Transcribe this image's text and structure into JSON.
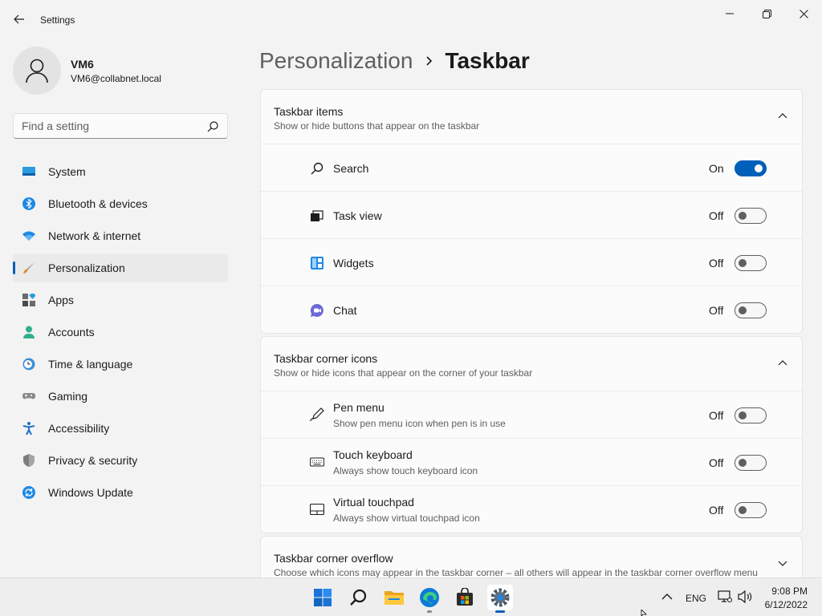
{
  "window": {
    "title": "Settings",
    "back_icon": "back-arrow-icon",
    "controls": [
      "minimize-icon",
      "restore-icon",
      "close-icon"
    ]
  },
  "profile": {
    "name": "VM6",
    "email": "VM6@collabnet.local"
  },
  "search": {
    "placeholder": "Find a setting"
  },
  "sidebar": {
    "items": [
      {
        "label": "System",
        "icon": "system-icon"
      },
      {
        "label": "Bluetooth & devices",
        "icon": "bluetooth-icon"
      },
      {
        "label": "Network & internet",
        "icon": "wifi-icon"
      },
      {
        "label": "Personalization",
        "icon": "brush-icon",
        "active": true
      },
      {
        "label": "Apps",
        "icon": "apps-icon"
      },
      {
        "label": "Accounts",
        "icon": "accounts-icon"
      },
      {
        "label": "Time & language",
        "icon": "clock-globe-icon"
      },
      {
        "label": "Gaming",
        "icon": "controller-icon"
      },
      {
        "label": "Accessibility",
        "icon": "accessibility-icon"
      },
      {
        "label": "Privacy & security",
        "icon": "shield-icon"
      },
      {
        "label": "Windows Update",
        "icon": "update-icon"
      }
    ]
  },
  "breadcrumb": {
    "parent": "Personalization",
    "current": "Taskbar"
  },
  "sections": [
    {
      "title": "Taskbar items",
      "subtitle": "Show or hide buttons that appear on the taskbar",
      "expanded": true,
      "rows": [
        {
          "label": "Search",
          "state": "On",
          "on": true,
          "icon": "search-icon"
        },
        {
          "label": "Task view",
          "state": "Off",
          "on": false,
          "icon": "task-view-icon"
        },
        {
          "label": "Widgets",
          "state": "Off",
          "on": false,
          "icon": "widgets-icon"
        },
        {
          "label": "Chat",
          "state": "Off",
          "on": false,
          "icon": "chat-icon"
        }
      ]
    },
    {
      "title": "Taskbar corner icons",
      "subtitle": "Show or hide icons that appear on the corner of your taskbar",
      "expanded": true,
      "rows": [
        {
          "label": "Pen menu",
          "sub": "Show pen menu icon when pen is in use",
          "state": "Off",
          "on": false,
          "icon": "pen-icon"
        },
        {
          "label": "Touch keyboard",
          "sub": "Always show touch keyboard icon",
          "state": "Off",
          "on": false,
          "icon": "keyboard-icon"
        },
        {
          "label": "Virtual touchpad",
          "sub": "Always show virtual touchpad icon",
          "state": "Off",
          "on": false,
          "icon": "touchpad-icon"
        }
      ]
    },
    {
      "title": "Taskbar corner overflow",
      "subtitle": "Choose which icons may appear in the taskbar corner – all others will appear in the taskbar corner overflow menu",
      "expanded": false
    }
  ],
  "taskbar": {
    "apps": [
      "start-icon",
      "search-icon",
      "file-explorer-icon",
      "edge-icon",
      "store-icon",
      "settings-icon"
    ],
    "active_app": "settings-icon",
    "language": "ENG",
    "time": "9:08 PM",
    "date": "6/12/2022"
  },
  "colors": {
    "accent": "#005fb8",
    "background": "#f3f3f3",
    "card": "#fbfbfb"
  }
}
